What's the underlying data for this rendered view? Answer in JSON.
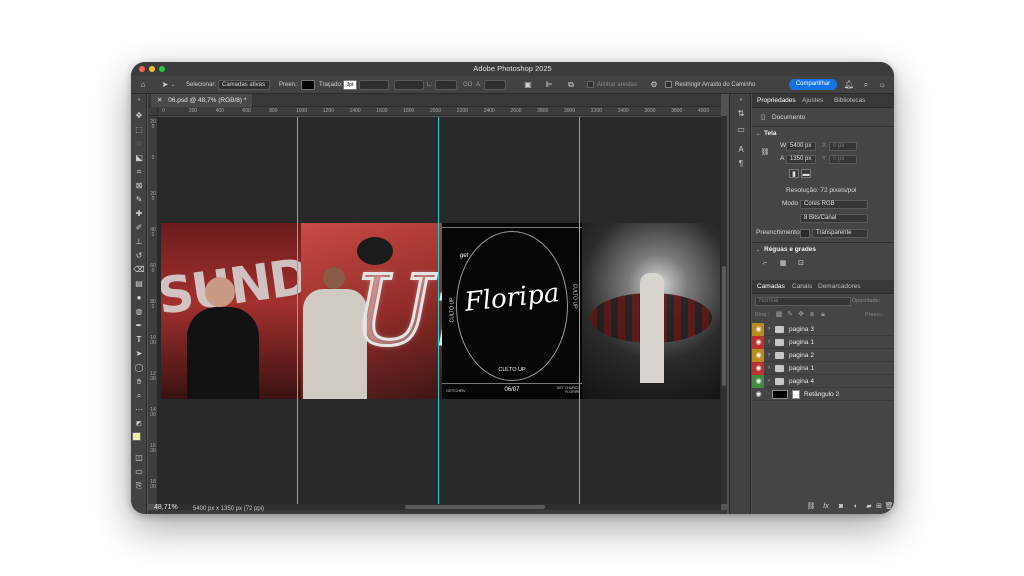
{
  "app": {
    "title": "Adobe Photoshop 2025"
  },
  "options_bar": {
    "home_icon": "home-icon",
    "move_tool_icon": "move-arrow-icon",
    "select_label": "Selecionar:",
    "select_value": "Camadas ativas",
    "fill_label": "Preen.:",
    "stroke_label": "Traçado:",
    "stroke_value": "3pt",
    "x_label": "L:",
    "w_label": "A:",
    "align_edges_label": "Alinhar arestas",
    "restrict_label": "Restringir Arrasto do Caminho",
    "share_label": "Compartilhar",
    "go_label": "GO"
  },
  "document": {
    "tab_label": "06.psd @ 48,7% (RGB/8) *",
    "zoom": "48,71%",
    "size": "5400 px x 1350 px (72 ppi)"
  },
  "ruler_h": [
    "0",
    "200",
    "400",
    "600",
    "800",
    "1000",
    "1200",
    "1400",
    "1600",
    "1800",
    "2000",
    "2200",
    "2400",
    "2600",
    "2800",
    "3000",
    "3200",
    "3400",
    "3600",
    "3800",
    "4000",
    "4200"
  ],
  "ruler_v": [
    "200",
    "0",
    "200",
    "400",
    "600",
    "800",
    "1000",
    "1200",
    "1400",
    "1600",
    "1800"
  ],
  "artwork": {
    "sunday": "SUNDAY",
    "script_ur": "Ur",
    "script_floripa": "Floripa",
    "mark": "get",
    "culto_up_side_left": "CULTO UP",
    "culto_up_side_right": "CULTO UP",
    "culto_up_bottom": "CULTO UP",
    "date": "06/07",
    "footer_left": "GETCHRV",
    "footer_right": "GET CHURCH FLORIPA"
  },
  "properties": {
    "tabs": [
      "Propriedades",
      "Ajustes",
      "Bibliotecas"
    ],
    "doc_label": "Documento",
    "canvas_section": "Tela",
    "w_label": "W",
    "w_value": "5400 px",
    "h_label": "A",
    "h_value": "1350 px",
    "x_label": "X",
    "x_value": "0 px",
    "y_label": "Y",
    "y_value": "0 px",
    "resolution": "Resolução: 72 pixels/pol",
    "mode_label": "Modo",
    "mode_value": "Cores RGB",
    "bits_value": "8 Bits/Canal",
    "fill_label": "Preenchimento",
    "fill_value": "Transparente",
    "rulers_section": "Réguas e grades"
  },
  "layers": {
    "tabs": [
      "Camadas",
      "Canais",
      "Demarcadores"
    ],
    "blend_mode": "Normal",
    "opacity_label": "Opacidade:",
    "lock_label": "Bloq.:",
    "fill_label": "Preen.:",
    "items": [
      {
        "name": "pagina 3",
        "color": "#b98a1d"
      },
      {
        "name": "pagina 1",
        "color": "#b83232"
      },
      {
        "name": "pagina 2",
        "color": "#b98a1d"
      },
      {
        "name": "pagina 1",
        "color": "#b83232"
      },
      {
        "name": "pagina 4",
        "color": "#3f8a3f"
      },
      {
        "name": "Retângulo 2",
        "color": ""
      }
    ]
  }
}
